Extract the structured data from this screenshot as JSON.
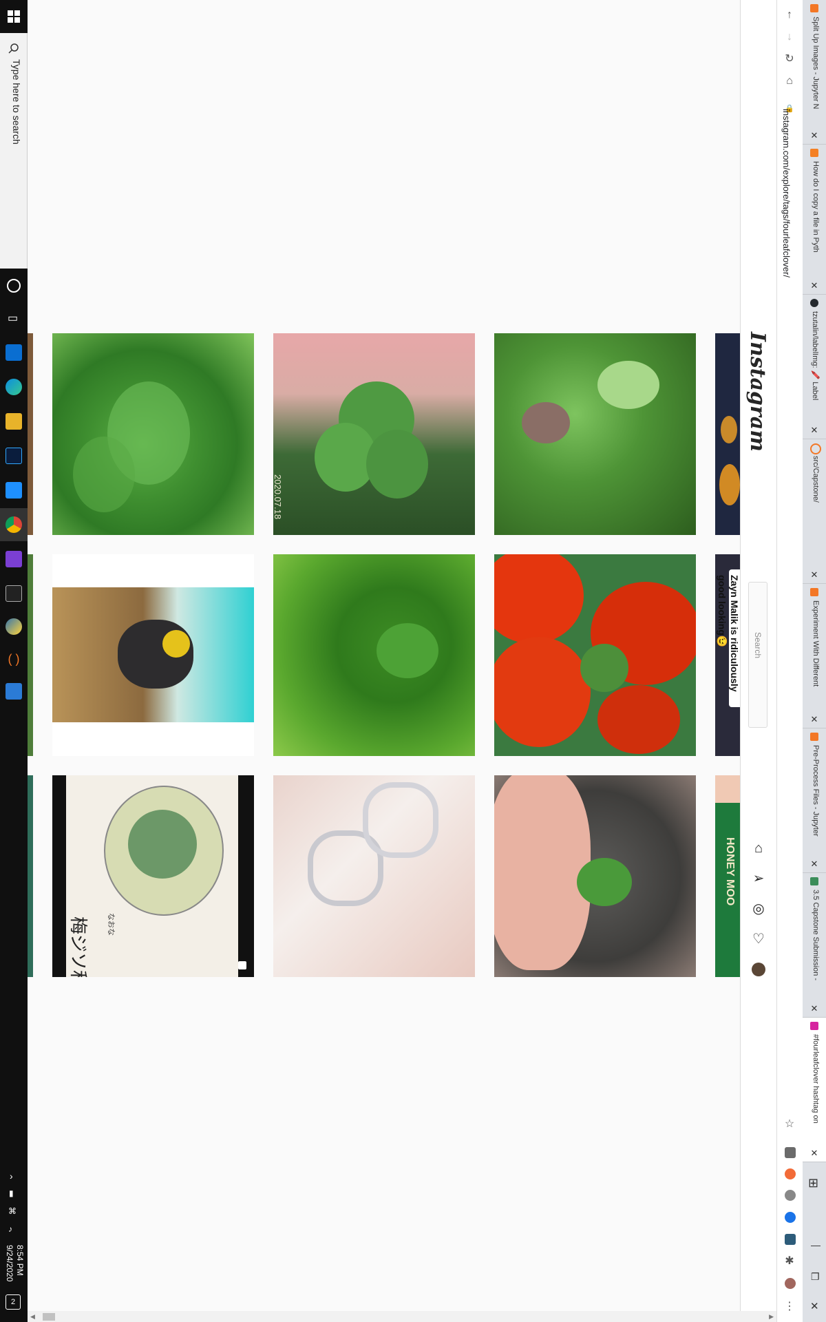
{
  "taskbar": {
    "search_placeholder": "Type here to search",
    "clock_time": "8:54 PM",
    "clock_date": "9/24/2020",
    "notification_count": "2"
  },
  "browser": {
    "url": "instagram.com/explore/tags/fourleafclover/",
    "tabs": [
      {
        "label": "Split Up Images - Jupyter N",
        "icon": "jupyter-icon",
        "color": "#f37726"
      },
      {
        "label": "How do I copy a file in Pyth",
        "icon": "stackoverflow-icon",
        "color": "#f48024"
      },
      {
        "label": "tzutalin/labelImg: 🖍️ Label",
        "icon": "github-icon",
        "color": "#24292e"
      },
      {
        "label": "src/Capstone/",
        "icon": "jupyter-folder-icon",
        "color": "#f37726"
      },
      {
        "label": "Experiment With Different",
        "icon": "jupyter-icon",
        "color": "#f37726"
      },
      {
        "label": "Pre-Process Files - Jupyter",
        "icon": "jupyter-icon",
        "color": "#f37726"
      },
      {
        "label": "3.5 Capstone Submission -",
        "icon": "course-icon",
        "color": "#3b8d5a"
      },
      {
        "label": "#fourleafclover hashtag on",
        "icon": "instagram-icon",
        "color": "#d6249f"
      }
    ]
  },
  "instagram": {
    "logo": "Instagram",
    "search_placeholder": "Search"
  },
  "grid": {
    "photo_date_stamp": "2020.07.18",
    "sticker_text_line1": "Zayn Malik is ridiculously",
    "sticker_text_line2": "good looking😉",
    "jar_label": "HONEY MOO",
    "art_caption": "梅ジソ和え",
    "art_signature": "なおな"
  }
}
